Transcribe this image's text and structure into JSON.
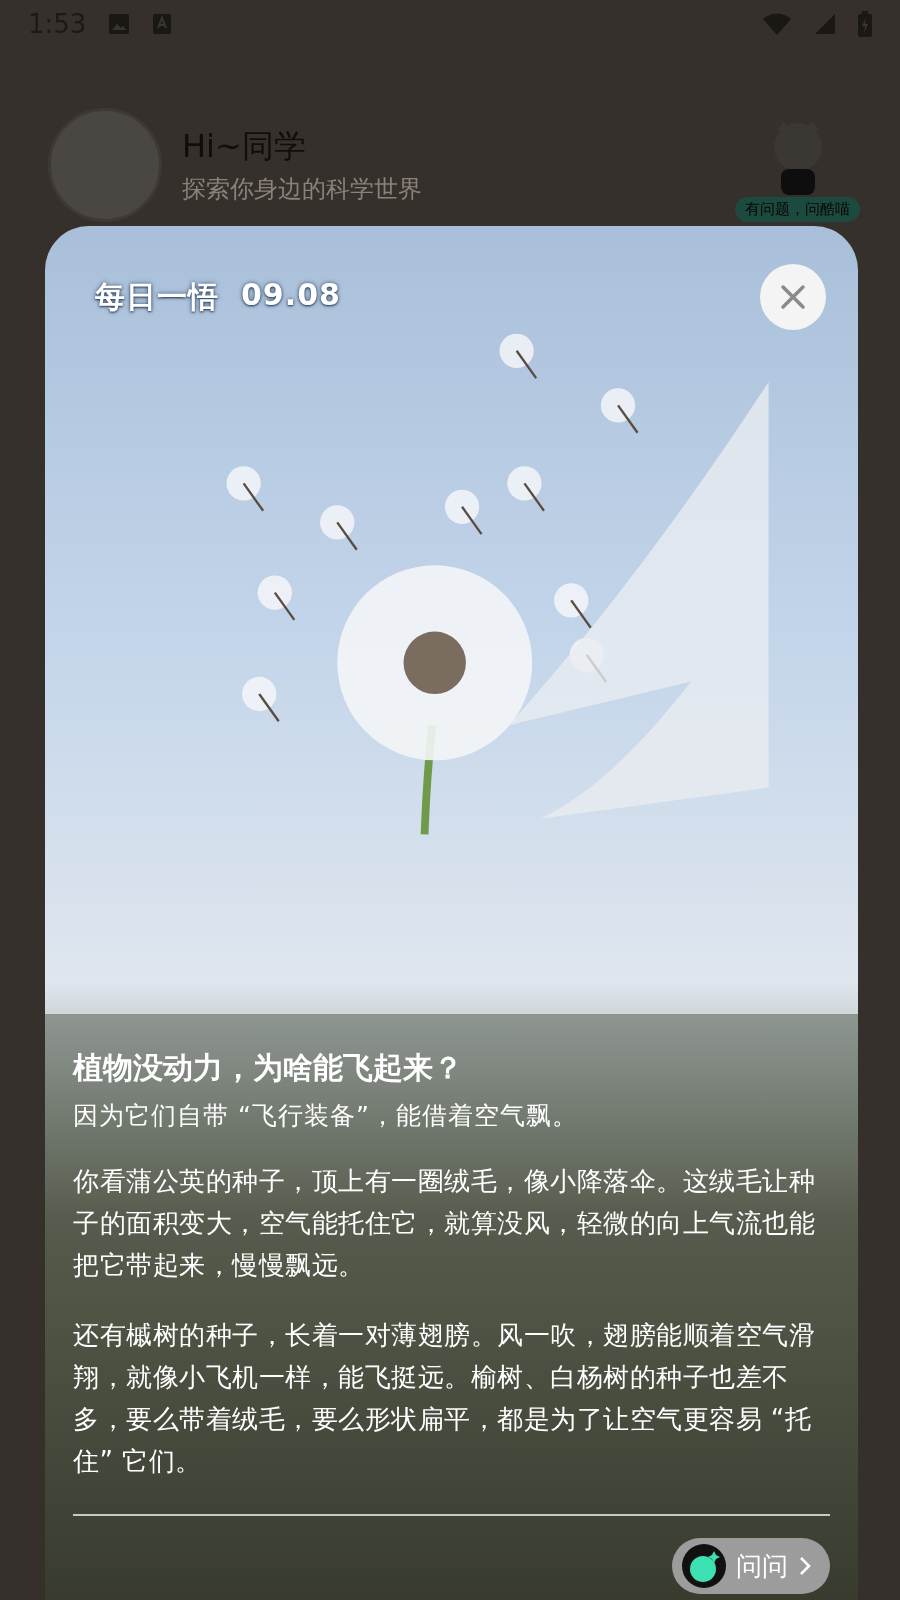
{
  "status_bar": {
    "time": "1:53"
  },
  "header": {
    "greeting": "Hi~同学",
    "subtitle": "探索你身边的科学世界",
    "mascot_badge": "有问题，问酷喵"
  },
  "card": {
    "heading": "每日一悟",
    "date": "09.08",
    "title": "植物没动力，为啥能飞起来？",
    "lead": "因为它们自带 “飞行装备”，能借着空气飘。",
    "paragraphs": [
      "你看蒲公英的种子，顶上有一圈绒毛，像小降落伞。这绒毛让种子的面积变大，空气能托住它，就算没风，轻微的向上气流也能把它带起来，慢慢飘远。",
      "还有槭树的种子，长着一对薄翅膀。风一吹，翅膀能顺着空气滑翔，就像小飞机一样，能飞挺远。榆树、白杨树的种子也差不多，要么带着绒毛，要么形状扁平，都是为了让空气更容易 “托住” 它们。"
    ],
    "ask_button": "问问"
  }
}
